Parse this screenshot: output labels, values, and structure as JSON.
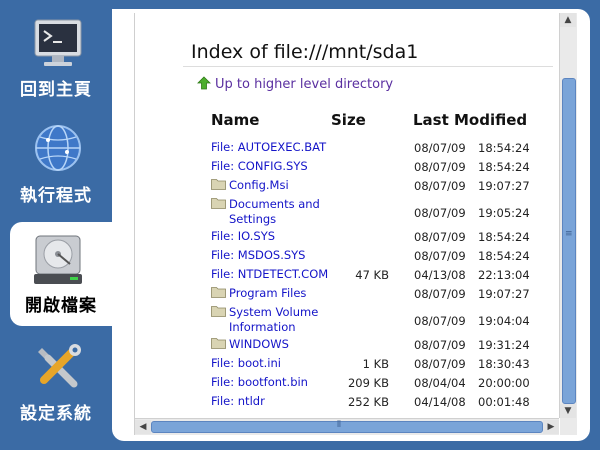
{
  "sidebar": {
    "items": [
      {
        "label": "回到主頁",
        "icon": "terminal-icon"
      },
      {
        "label": "執行程式",
        "icon": "globe-icon"
      },
      {
        "label": "開啟檔案",
        "icon": "hard-drive-icon"
      },
      {
        "label": "設定系統",
        "icon": "tools-icon"
      }
    ]
  },
  "listing": {
    "title": "Index of file:///mnt/sda1",
    "up_link": "Up to higher level directory",
    "headers": {
      "name": "Name",
      "size": "Size",
      "modified": "Last Modified"
    },
    "rows": [
      {
        "name": "File: AUTOEXEC.BAT",
        "type": "file",
        "size": "",
        "date": "08/07/09",
        "time": "18:54:24"
      },
      {
        "name": "File: CONFIG.SYS",
        "type": "file",
        "size": "",
        "date": "08/07/09",
        "time": "18:54:24"
      },
      {
        "name": "Config.Msi",
        "type": "folder",
        "size": "",
        "date": "08/07/09",
        "time": "19:07:27"
      },
      {
        "name": "Documents and",
        "name2": "Settings",
        "type": "folder",
        "size": "",
        "date": "08/07/09",
        "time": "19:05:24"
      },
      {
        "name": "File: IO.SYS",
        "type": "file",
        "size": "",
        "date": "08/07/09",
        "time": "18:54:24"
      },
      {
        "name": "File: MSDOS.SYS",
        "type": "file",
        "size": "",
        "date": "08/07/09",
        "time": "18:54:24"
      },
      {
        "name": "File: NTDETECT.COM",
        "type": "file",
        "size": "47 KB",
        "date": "04/13/08",
        "time": "22:13:04"
      },
      {
        "name": "Program Files",
        "type": "folder",
        "size": "",
        "date": "08/07/09",
        "time": "19:07:27"
      },
      {
        "name": "System Volume",
        "name2": "Information",
        "type": "folder",
        "size": "",
        "date": "08/07/09",
        "time": "19:04:04"
      },
      {
        "name": "WINDOWS",
        "type": "folder",
        "size": "",
        "date": "08/07/09",
        "time": "19:31:24"
      },
      {
        "name": "File: boot.ini",
        "type": "file",
        "size": "1 KB",
        "date": "08/07/09",
        "time": "18:30:43"
      },
      {
        "name": "File: bootfont.bin",
        "type": "file",
        "size": "209 KB",
        "date": "08/04/04",
        "time": "20:00:00"
      },
      {
        "name": "File: ntldr",
        "type": "file",
        "size": "252 KB",
        "date": "04/14/08",
        "time": "00:01:48"
      }
    ]
  },
  "colors": {
    "sidebar_bg": "#3b6ba5",
    "link": "#1414c8",
    "visited": "#5a2fa0",
    "scroll_thumb": "#7aa4d8"
  }
}
